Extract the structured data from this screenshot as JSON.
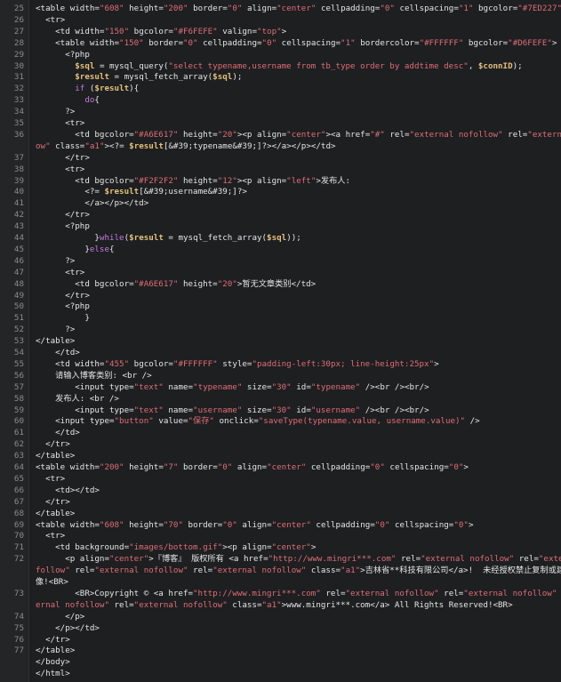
{
  "editor": {
    "lines": [
      {
        "n": "25",
        "segs": [
          [
            "t",
            "<table width="
          ],
          [
            "s",
            "\"608\""
          ],
          [
            "t",
            " height="
          ],
          [
            "s",
            "\"200\""
          ],
          [
            "t",
            " border="
          ],
          [
            "s",
            "\"0\""
          ],
          [
            "t",
            " align="
          ],
          [
            "s",
            "\"center\""
          ],
          [
            "t",
            " cellpadding="
          ],
          [
            "s",
            "\"0\""
          ],
          [
            "t",
            " cellspacing="
          ],
          [
            "s",
            "\"1\""
          ],
          [
            "t",
            " bgcolor="
          ],
          [
            "s",
            "\"#7ED227\""
          ],
          [
            "t",
            ">"
          ]
        ]
      },
      {
        "n": "26",
        "segs": [
          [
            "t",
            "  <tr>"
          ]
        ]
      },
      {
        "n": "27",
        "segs": [
          [
            "t",
            "    <td width="
          ],
          [
            "s",
            "\"150\""
          ],
          [
            "t",
            " bgcolor="
          ],
          [
            "s",
            "\"#F6FEFE\""
          ],
          [
            "t",
            " valign="
          ],
          [
            "s",
            "\"top\""
          ],
          [
            "t",
            ">"
          ]
        ]
      },
      {
        "n": "28",
        "segs": [
          [
            "t",
            "    <table width="
          ],
          [
            "s",
            "\"150\""
          ],
          [
            "t",
            " border="
          ],
          [
            "s",
            "\"0\""
          ],
          [
            "t",
            " cellpadding="
          ],
          [
            "s",
            "\"0\""
          ],
          [
            "t",
            " cellspacing="
          ],
          [
            "s",
            "\"1\""
          ],
          [
            "t",
            " bordercolor="
          ],
          [
            "s",
            "\"#FFFFFF\""
          ],
          [
            "t",
            " bgcolor="
          ],
          [
            "s",
            "\"#D6FEFE\""
          ],
          [
            "t",
            ">"
          ]
        ]
      },
      {
        "n": "29",
        "segs": [
          [
            "t",
            "      <?php"
          ]
        ]
      },
      {
        "n": "30",
        "segs": [
          [
            "t",
            "        "
          ],
          [
            "v",
            "$sql"
          ],
          [
            "t",
            " = mysql_query("
          ],
          [
            "s",
            "\"select typename,username from tb_type order by addtime desc\""
          ],
          [
            "t",
            ", "
          ],
          [
            "v",
            "$connID"
          ],
          [
            "t",
            ");"
          ]
        ]
      },
      {
        "n": "31",
        "segs": [
          [
            "t",
            "        "
          ],
          [
            "v",
            "$result"
          ],
          [
            "t",
            " = mysql_fetch_array("
          ],
          [
            "v",
            "$sql"
          ],
          [
            "t",
            ");"
          ]
        ]
      },
      {
        "n": "32",
        "segs": [
          [
            "t",
            "        "
          ],
          [
            "k",
            "if"
          ],
          [
            "t",
            " ("
          ],
          [
            "v",
            "$result"
          ],
          [
            "t",
            "){"
          ]
        ]
      },
      {
        "n": "33",
        "segs": [
          [
            "t",
            "          "
          ],
          [
            "k",
            "do"
          ],
          [
            "t",
            "{"
          ]
        ]
      },
      {
        "n": "34",
        "segs": [
          [
            "t",
            "      ?>"
          ]
        ]
      },
      {
        "n": "35",
        "segs": [
          [
            "t",
            "      <tr>"
          ]
        ]
      },
      {
        "n": "36",
        "segs": [
          [
            "t",
            "        <td bgcolor="
          ],
          [
            "s",
            "\"#A6E617\""
          ],
          [
            "t",
            " height="
          ],
          [
            "s",
            "\"20\""
          ],
          [
            "t",
            "><p align="
          ],
          [
            "s",
            "\"center\""
          ],
          [
            "t",
            "><a href="
          ],
          [
            "s",
            "\"#\""
          ],
          [
            "t",
            " rel="
          ],
          [
            "s",
            "\"external nofollow\""
          ],
          [
            "t",
            " rel="
          ],
          [
            "s",
            "\"external nofoll"
          ]
        ]
      },
      {
        "n": "",
        "segs": [
          [
            "s",
            "ow\""
          ],
          [
            "t",
            " class="
          ],
          [
            "s",
            "\"a1\""
          ],
          [
            "t",
            ">"
          ],
          [
            "t",
            "<?= "
          ],
          [
            "v",
            "$result"
          ],
          [
            "t",
            "[&#39;typename&#39;]?></a></p></td>"
          ]
        ]
      },
      {
        "n": "37",
        "segs": [
          [
            "t",
            "      </tr>"
          ]
        ]
      },
      {
        "n": "38",
        "segs": [
          [
            "t",
            "      <tr>"
          ]
        ]
      },
      {
        "n": "39",
        "segs": [
          [
            "t",
            "        <td bgcolor="
          ],
          [
            "s",
            "\"#F2F2F2\""
          ],
          [
            "t",
            " height="
          ],
          [
            "s",
            "\"12\""
          ],
          [
            "t",
            "><p align="
          ],
          [
            "s",
            "\"left\""
          ],
          [
            "t",
            ">发布人:"
          ]
        ]
      },
      {
        "n": "40",
        "segs": [
          [
            "t",
            "          <?= "
          ],
          [
            "v",
            "$result"
          ],
          [
            "t",
            "[&#39;username&#39;]?>"
          ]
        ]
      },
      {
        "n": "41",
        "segs": [
          [
            "t",
            "          </a></p></td>"
          ]
        ]
      },
      {
        "n": "42",
        "segs": [
          [
            "t",
            "      </tr>"
          ]
        ]
      },
      {
        "n": "43",
        "segs": [
          [
            "t",
            "      <?php"
          ]
        ]
      },
      {
        "n": "44",
        "segs": [
          [
            "t",
            "            }"
          ],
          [
            "k",
            "while"
          ],
          [
            "t",
            "("
          ],
          [
            "v",
            "$result"
          ],
          [
            "t",
            " = mysql_fetch_array("
          ],
          [
            "v",
            "$sql"
          ],
          [
            "t",
            "));"
          ]
        ]
      },
      {
        "n": "45",
        "segs": [
          [
            "t",
            "          }"
          ],
          [
            "k",
            "else"
          ],
          [
            "t",
            "{"
          ]
        ]
      },
      {
        "n": "46",
        "segs": [
          [
            "t",
            "      ?>"
          ]
        ]
      },
      {
        "n": "47",
        "segs": [
          [
            "t",
            "      <tr>"
          ]
        ]
      },
      {
        "n": "48",
        "segs": [
          [
            "t",
            "        <td bgcolor="
          ],
          [
            "s",
            "\"#A6E617\""
          ],
          [
            "t",
            " height="
          ],
          [
            "s",
            "\"20\""
          ],
          [
            "t",
            ">暂无文章类别</td>"
          ]
        ]
      },
      {
        "n": "49",
        "segs": [
          [
            "t",
            "      </tr>"
          ]
        ]
      },
      {
        "n": "50",
        "segs": [
          [
            "t",
            "      <?php"
          ]
        ]
      },
      {
        "n": "51",
        "segs": [
          [
            "t",
            "          }"
          ]
        ]
      },
      {
        "n": "52",
        "segs": [
          [
            "t",
            "      ?>"
          ]
        ]
      },
      {
        "n": "53",
        "segs": [
          [
            "t",
            "</table>"
          ]
        ]
      },
      {
        "n": "54",
        "segs": [
          [
            "t",
            "    </td>"
          ]
        ]
      },
      {
        "n": "55",
        "segs": [
          [
            "t",
            "    <td width="
          ],
          [
            "s",
            "\"455\""
          ],
          [
            "t",
            " bgcolor="
          ],
          [
            "s",
            "\"#FFFFFF\""
          ],
          [
            "t",
            " style="
          ],
          [
            "s",
            "\"padding-left:30px; line-height:25px\""
          ],
          [
            "t",
            ">"
          ]
        ]
      },
      {
        "n": "56",
        "segs": [
          [
            "t",
            "    请输入博客类别: <br />"
          ]
        ]
      },
      {
        "n": "57",
        "segs": [
          [
            "t",
            "        <input type="
          ],
          [
            "s",
            "\"text\""
          ],
          [
            "t",
            " name="
          ],
          [
            "s",
            "\"typename\""
          ],
          [
            "t",
            " size="
          ],
          [
            "s",
            "\"30\""
          ],
          [
            "t",
            " id="
          ],
          [
            "s",
            "\"typename\""
          ],
          [
            "t",
            " /><br /><br/>"
          ]
        ]
      },
      {
        "n": "58",
        "segs": [
          [
            "t",
            "    发布人: <br />"
          ]
        ]
      },
      {
        "n": "59",
        "segs": [
          [
            "t",
            "        <input type="
          ],
          [
            "s",
            "\"text\""
          ],
          [
            "t",
            " name="
          ],
          [
            "s",
            "\"username\""
          ],
          [
            "t",
            " size="
          ],
          [
            "s",
            "\"30\""
          ],
          [
            "t",
            " id="
          ],
          [
            "s",
            "\"username\""
          ],
          [
            "t",
            " /><br /><br/>"
          ]
        ]
      },
      {
        "n": "60",
        "segs": [
          [
            "t",
            "    <input type="
          ],
          [
            "s",
            "\"button\""
          ],
          [
            "t",
            " value="
          ],
          [
            "s",
            "\"保存\""
          ],
          [
            "t",
            " onclick="
          ],
          [
            "s",
            "\"saveType(typename.value, username.value)\""
          ],
          [
            "t",
            " />"
          ]
        ]
      },
      {
        "n": "61",
        "segs": [
          [
            "t",
            "    </td>"
          ]
        ]
      },
      {
        "n": "62",
        "segs": [
          [
            "t",
            "  </tr>"
          ]
        ]
      },
      {
        "n": "63",
        "segs": [
          [
            "t",
            "</table>"
          ]
        ]
      },
      {
        "n": "64",
        "segs": [
          [
            "t",
            "<table width="
          ],
          [
            "s",
            "\"200\""
          ],
          [
            "t",
            " height="
          ],
          [
            "s",
            "\"7\""
          ],
          [
            "t",
            " border="
          ],
          [
            "s",
            "\"0\""
          ],
          [
            "t",
            " align="
          ],
          [
            "s",
            "\"center\""
          ],
          [
            "t",
            " cellpadding="
          ],
          [
            "s",
            "\"0\""
          ],
          [
            "t",
            " cellspacing="
          ],
          [
            "s",
            "\"0\""
          ],
          [
            "t",
            ">"
          ]
        ]
      },
      {
        "n": "65",
        "segs": [
          [
            "t",
            "  <tr>"
          ]
        ]
      },
      {
        "n": "66",
        "segs": [
          [
            "t",
            "    <td></td>"
          ]
        ]
      },
      {
        "n": "67",
        "segs": [
          [
            "t",
            "  </tr>"
          ]
        ]
      },
      {
        "n": "68",
        "segs": [
          [
            "t",
            "</table>"
          ]
        ]
      },
      {
        "n": "69",
        "segs": [
          [
            "t",
            "<table width="
          ],
          [
            "s",
            "\"608\""
          ],
          [
            "t",
            " height="
          ],
          [
            "s",
            "\"70\""
          ],
          [
            "t",
            " border="
          ],
          [
            "s",
            "\"0\""
          ],
          [
            "t",
            " align="
          ],
          [
            "s",
            "\"center\""
          ],
          [
            "t",
            " cellpadding="
          ],
          [
            "s",
            "\"0\""
          ],
          [
            "t",
            " cellspacing="
          ],
          [
            "s",
            "\"0\""
          ],
          [
            "t",
            ">"
          ]
        ]
      },
      {
        "n": "70",
        "segs": [
          [
            "t",
            "  <tr>"
          ]
        ]
      },
      {
        "n": "71",
        "segs": [
          [
            "t",
            "    <td background="
          ],
          [
            "s",
            "\"images/bottom.gif\""
          ],
          [
            "t",
            "><p align="
          ],
          [
            "s",
            "\"center\""
          ],
          [
            "t",
            ">"
          ]
        ]
      },
      {
        "n": "72",
        "segs": [
          [
            "t",
            "      <p align="
          ],
          [
            "s",
            "\"center\""
          ],
          [
            "t",
            ">『博客』 版权所有 <a href="
          ],
          [
            "s",
            "\"http://www.mingri***.com\""
          ],
          [
            "t",
            " rel="
          ],
          [
            "s",
            "\"external nofollow\""
          ],
          [
            "t",
            " rel="
          ],
          [
            "s",
            "\"external no"
          ]
        ]
      },
      {
        "n": "",
        "segs": [
          [
            "s",
            "follow\""
          ],
          [
            "t",
            " rel="
          ],
          [
            "s",
            "\"external nofollow\""
          ],
          [
            "t",
            " rel="
          ],
          [
            "s",
            "\"external nofollow\""
          ],
          [
            "t",
            " class="
          ],
          [
            "s",
            "\"a1\""
          ],
          [
            "t",
            ">吉林省**科技有限公司</a>!  未经授权禁止复制或建立镜"
          ]
        ]
      },
      {
        "n": "",
        "segs": [
          [
            "t",
            "像!<BR>"
          ]
        ]
      },
      {
        "n": "73",
        "segs": [
          [
            "t",
            "        <BR>Copyright © <a href="
          ],
          [
            "s",
            "\"http://www.mingri***.com\""
          ],
          [
            "t",
            " rel="
          ],
          [
            "s",
            "\"external nofollow\""
          ],
          [
            "t",
            " rel="
          ],
          [
            "s",
            "\"external nofollow\""
          ],
          [
            "t",
            " rel="
          ],
          [
            "s",
            "\"ext"
          ]
        ]
      },
      {
        "n": "",
        "segs": [
          [
            "s",
            "ernal nofollow\""
          ],
          [
            "t",
            " rel="
          ],
          [
            "s",
            "\"external nofollow\""
          ],
          [
            "t",
            " class="
          ],
          [
            "s",
            "\"a1\""
          ],
          [
            "t",
            ">www.mingri***.com</a> All Rights Reserved!<BR>"
          ]
        ]
      },
      {
        "n": "74",
        "segs": [
          [
            "t",
            "      </p>"
          ]
        ]
      },
      {
        "n": "75",
        "segs": [
          [
            "t",
            "    </p></td>"
          ]
        ]
      },
      {
        "n": "76",
        "segs": [
          [
            "t",
            "  </tr>"
          ]
        ]
      },
      {
        "n": "77",
        "segs": [
          [
            "t",
            "</table>"
          ]
        ]
      },
      {
        "n": "",
        "segs": [
          [
            "t",
            "</body>"
          ]
        ]
      },
      {
        "n": "",
        "segs": [
          [
            "t",
            "</html>"
          ]
        ]
      }
    ]
  }
}
